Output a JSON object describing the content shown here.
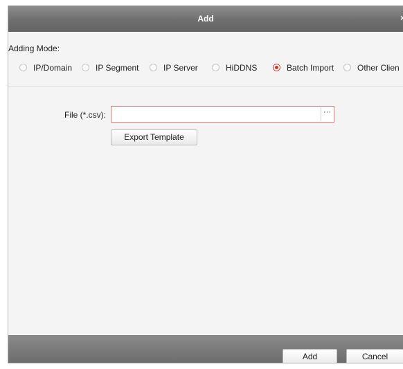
{
  "dialog": {
    "title": "Add",
    "close_symbol": "×"
  },
  "adding_mode": {
    "label": "Adding Mode:",
    "options": [
      {
        "label": "IP/Domain",
        "checked": false
      },
      {
        "label": "IP Segment",
        "checked": false
      },
      {
        "label": "IP Server",
        "checked": false
      },
      {
        "label": "HiDDNS",
        "checked": false
      },
      {
        "label": "Batch Import",
        "checked": true
      },
      {
        "label": "Other Clien",
        "checked": false
      }
    ]
  },
  "file": {
    "label": "File (*.csv):",
    "value": "",
    "browse_label": "···"
  },
  "export_template_label": "Export Template",
  "footer": {
    "add_label": "Add",
    "cancel_label": "Cancel"
  },
  "colors": {
    "accent": "#d9302a",
    "titlebar": "#7a7a7a"
  }
}
